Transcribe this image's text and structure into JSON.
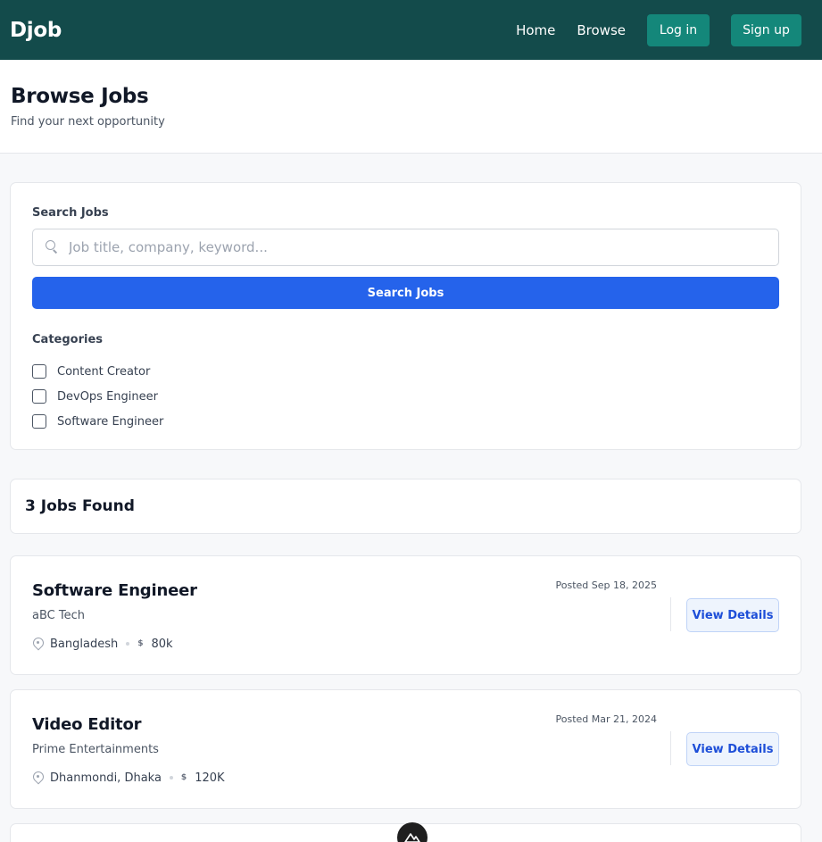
{
  "nav": {
    "brand": "Djob",
    "links": [
      "Home",
      "Browse"
    ],
    "login_label": "Log in",
    "signup_label": "Sign up"
  },
  "header": {
    "title": "Browse Jobs",
    "subtitle": "Find your next opportunity"
  },
  "search": {
    "label": "Search Jobs",
    "placeholder": "Job title, company, keyword...",
    "value": "",
    "button_label": "Search Jobs"
  },
  "categories": {
    "label": "Categories",
    "items": [
      {
        "label": "Content Creator",
        "checked": false
      },
      {
        "label": "DevOps Engineer",
        "checked": false
      },
      {
        "label": "Software Engineer",
        "checked": false
      }
    ]
  },
  "results": {
    "title": "3 Jobs Found"
  },
  "jobs": [
    {
      "title": "Software Engineer",
      "company": "aBC Tech",
      "location": "Bangladesh",
      "salary": "80k",
      "posted": "Posted Sep 18, 2025",
      "action_label": "View Details"
    },
    {
      "title": "Video Editor",
      "company": "Prime Entertainments",
      "location": "Dhanmondi, Dhaka",
      "salary": "120K",
      "posted": "Posted Mar 21, 2024",
      "action_label": "View Details"
    }
  ],
  "colors": {
    "navbar": "#134b4b",
    "accent_teal": "#14877a",
    "primary_blue": "#2563eb"
  }
}
